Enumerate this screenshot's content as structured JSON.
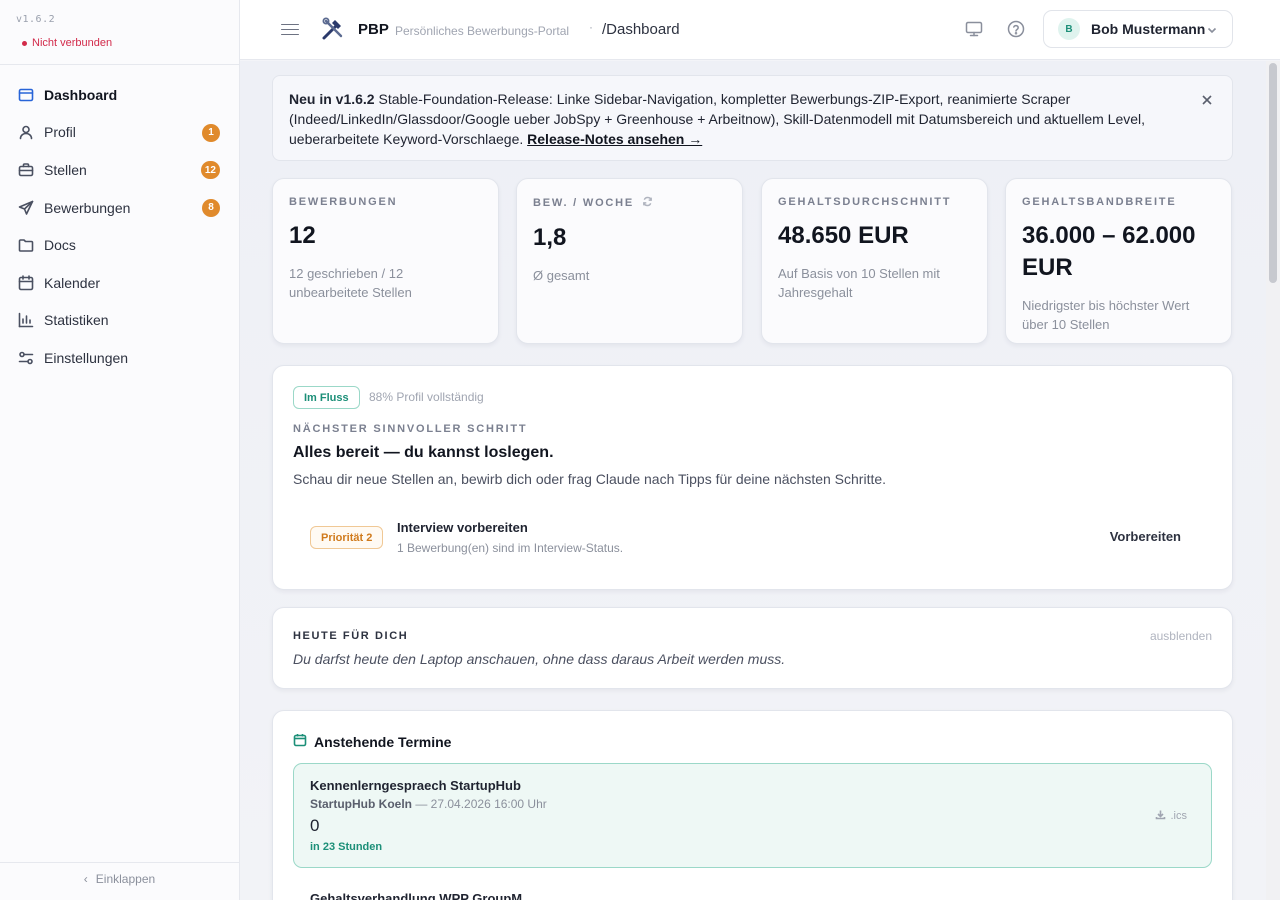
{
  "sidebar": {
    "version": "v1.6.2",
    "status": "Nicht verbunden",
    "items": [
      {
        "label": "Dashboard",
        "icon": "calendar-window-icon",
        "badge": ""
      },
      {
        "label": "Profil",
        "icon": "user-icon",
        "badge": "1"
      },
      {
        "label": "Stellen",
        "icon": "briefcase-icon",
        "badge": "12"
      },
      {
        "label": "Bewerbungen",
        "icon": "send-icon",
        "badge": "8"
      },
      {
        "label": "Docs",
        "icon": "folder-icon",
        "badge": ""
      },
      {
        "label": "Kalender",
        "icon": "calendar-icon",
        "badge": ""
      },
      {
        "label": "Statistiken",
        "icon": "bar-chart-icon",
        "badge": ""
      },
      {
        "label": "Einstellungen",
        "icon": "sliders-icon",
        "badge": ""
      }
    ],
    "collapse_label": "Einklappen"
  },
  "header": {
    "brand": "PBP",
    "subtitle": "Persönliches Bewerbungs-Portal",
    "separator": "·",
    "breadcrumb": "/Dashboard",
    "user": {
      "initial": "B",
      "name": "Bob Mustermann"
    }
  },
  "release": {
    "prefix": "Neu in v1.6.2",
    "text": " Stable-Foundation-Release: Linke Sidebar-Navigation, kompletter Bewerbungs-ZIP-Export, reanimierte Scraper (Indeed/LinkedIn/Glassdoor/Google ueber JobSpy + Greenhouse + Arbeitnow), Skill-Datenmodell mit Datumsbereich und aktuellem Level, ueberarbeitete Keyword-Vorschlaege. ",
    "link": "Release-Notes ansehen →"
  },
  "stats": [
    {
      "label": "BEWERBUNGEN",
      "value": "12",
      "sub": "12 geschrieben / 12 unbearbeitete Stellen"
    },
    {
      "label": "BEW. / WOCHE",
      "value": "1,8",
      "sub": "Ø gesamt"
    },
    {
      "label": "GEHALTSDURCHSCHNITT",
      "value": "48.650 EUR",
      "sub": "Auf Basis von 10 Stellen mit Jahresgehalt"
    },
    {
      "label": "GEHALTSBANDBREITE",
      "value": "36.000 – 62.000 EUR",
      "sub": "Niedrigster bis höchster Wert über 10 Stellen"
    }
  ],
  "next_step": {
    "flow_badge": "Im Fluss",
    "profile_complete": "88% Profil vollständig",
    "kicker": "NÄCHSTER SINNVOLLER SCHRITT",
    "title": "Alles bereit — du kannst loslegen.",
    "text": "Schau dir neue Stellen an, bewirb dich oder frag Claude nach Tipps für deine nächsten Schritte.",
    "task": {
      "priority": "Priorität 2",
      "title": "Interview vorbereiten",
      "sub": "1 Bewerbung(en) sind im Interview-Status.",
      "action": "Vorbereiten"
    }
  },
  "today": {
    "label": "HEUTE FÜR DICH",
    "hide": "ausblenden",
    "text": "Du darfst heute den Laptop anschauen, ohne dass daraus Arbeit werden muss."
  },
  "appointments": {
    "title": "Anstehende Termine",
    "items": [
      {
        "title": "Kennenlerngespraech StartupHub",
        "company": "StartupHub Koeln",
        "datetime": "— 27.04.2026 16:00 Uhr",
        "count": "0",
        "when": "in 23 Stunden",
        "ics": ".ics"
      },
      {
        "title": "Gehaltsverhandlung WPP GroupM"
      }
    ]
  },
  "colors": {
    "accent": "#2864d8",
    "badge": "#e08a2c",
    "success": "#1c8f78",
    "danger": "#d22a4a"
  }
}
